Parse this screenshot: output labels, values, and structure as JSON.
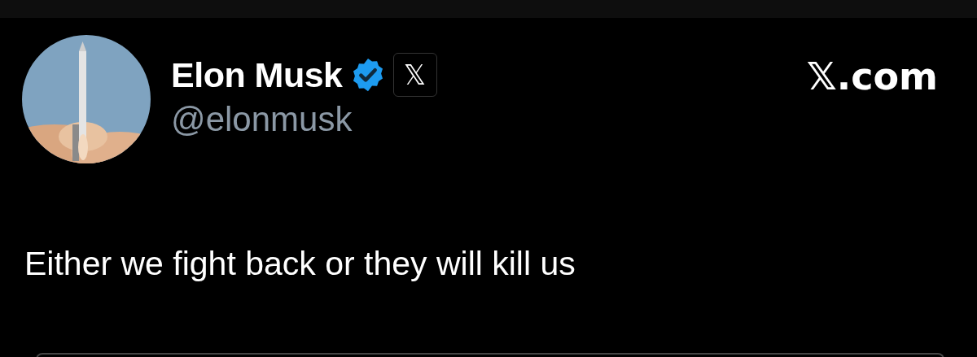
{
  "author": {
    "name": "Elon Musk",
    "verified": true,
    "badge": "𝕏",
    "handle": "@elonmusk"
  },
  "site": "𝕏.com",
  "text": "Either we fight back or they will kill us"
}
